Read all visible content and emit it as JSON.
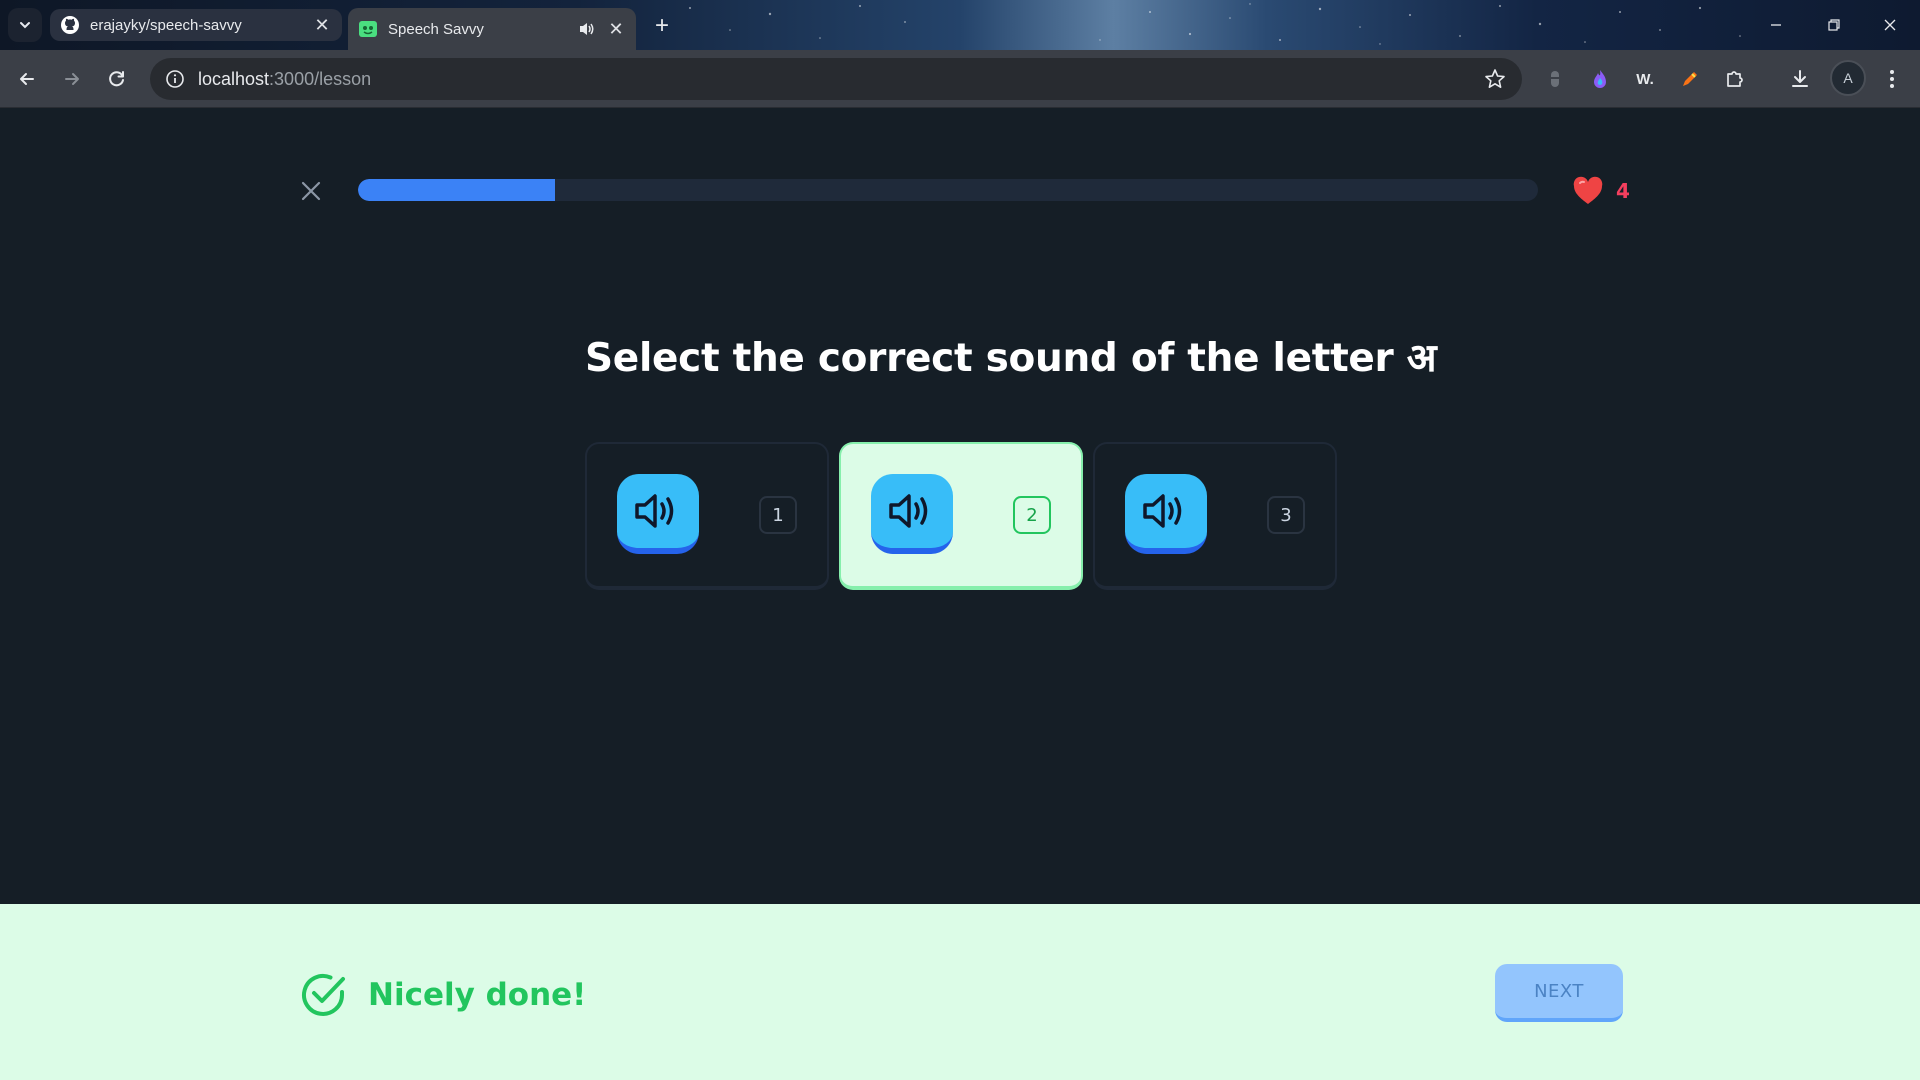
{
  "browser": {
    "tabs": [
      {
        "title": "erajayky/speech-savvy",
        "icon": "github-icon",
        "active": false
      },
      {
        "title": "Speech Savvy",
        "icon": "app-favicon",
        "active": true,
        "audio": true
      }
    ],
    "address": {
      "host": "localhost",
      "path": ":3000/lesson"
    },
    "profile_initial": "A",
    "extension_w_label": "W."
  },
  "lesson": {
    "progress_percent": 16.7,
    "hearts": "4",
    "question": "Select the correct sound of the letter अ",
    "options": [
      {
        "shortcut": "1",
        "selected": false
      },
      {
        "shortcut": "2",
        "selected": true
      },
      {
        "shortcut": "3",
        "selected": false
      }
    ]
  },
  "footer": {
    "status": "Nicely done!",
    "next_label": "NEXT"
  },
  "colors": {
    "accent": "#3b82f6",
    "sound_button": "#38bdf8",
    "correct": "#22c55e",
    "heart": "#f43f5e",
    "page_bg": "#151e26"
  }
}
